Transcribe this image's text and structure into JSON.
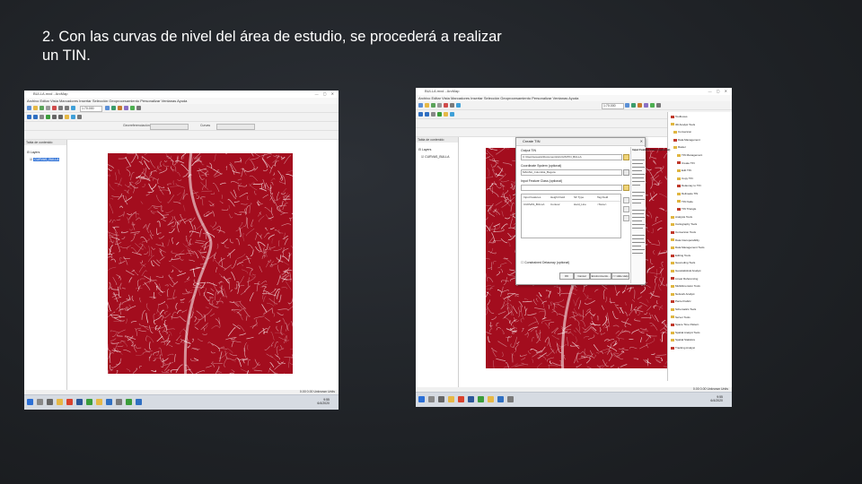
{
  "caption": {
    "line1": "2. Con las curvas de nivel del área de estudio, se procederá a realizar",
    "line2": "un TIN."
  },
  "colors": {
    "contour": "#a30d1e",
    "background": "#1f2226",
    "selection": "#3d7bd9"
  },
  "window": {
    "title": "BULLA.mxd - ArcMap",
    "menu": "Archivo  Editar  Vista  Marcadores  Insertar  Selección  Geoprocesamiento  Personalizar  Ventanas  Ayuda",
    "scale": "1:70.000",
    "zoom_label": "Georreferenciación",
    "layer_label": "Curvas",
    "toc_title": "Tabla de contenido",
    "toc_group": "Layers",
    "toc_layer": "CURVAS_BULLA",
    "status_coords": "0.00 0.00 Unknown Units"
  },
  "taskbar": {
    "time": "9:55",
    "date": "6/4/2020",
    "icons": [
      "windows-icon",
      "search-icon",
      "task-view-icon",
      "explorer-icon",
      "chrome-icon",
      "arcmap-icon",
      "word-icon"
    ]
  },
  "dialog": {
    "title": "Create TIN",
    "output_label": "Output TIN",
    "output_value": "C:\\Users\\usuario\\Documents\\ArcGIS\\TIN_BULLA",
    "sr_label": "Coordinate System (optional)",
    "sr_value": "MAGNA_Colombia_Bogota",
    "features_label": "Input Feature Class (optional)",
    "features_value": "",
    "columns": [
      "Input Features",
      "Height Field",
      "SF Type",
      "Tag Field"
    ],
    "row": [
      "CURVAS_BULLA",
      "Contour",
      "Hard_Line",
      "<None>"
    ],
    "constrained_label": "Constrained Delaunay (optional)",
    "buttons": [
      "OK",
      "Cancel",
      "Environments...",
      "<< Hide Help"
    ],
    "help_title": "Input Feature Class (optional)",
    "catalog_items": [
      "Toolboxes",
      "3D Analyst Tools",
      "Conversion",
      "Data Management",
      "Raster",
      "TIN Management",
      "Create TIN",
      "Edit TIN",
      "Copy TIN",
      "Delaunay to TIN",
      "Delineate TIN",
      "TIN Node",
      "TIN Triangle",
      "Analysis Tools",
      "Cartography Tools",
      "Conversion Tools",
      "Data Interoperability",
      "Data Management Tools",
      "Editing Tools",
      "Geocoding Tools",
      "Geostatistical Analyst",
      "Linear Referencing",
      "Multidimension Tools",
      "Network Analyst",
      "Parcel Fabric",
      "Schematics Tools",
      "Server Tools",
      "Space Time Pattern",
      "Spatial Analyst Tools",
      "Spatial Statistics",
      "Tracking Analyst"
    ]
  }
}
